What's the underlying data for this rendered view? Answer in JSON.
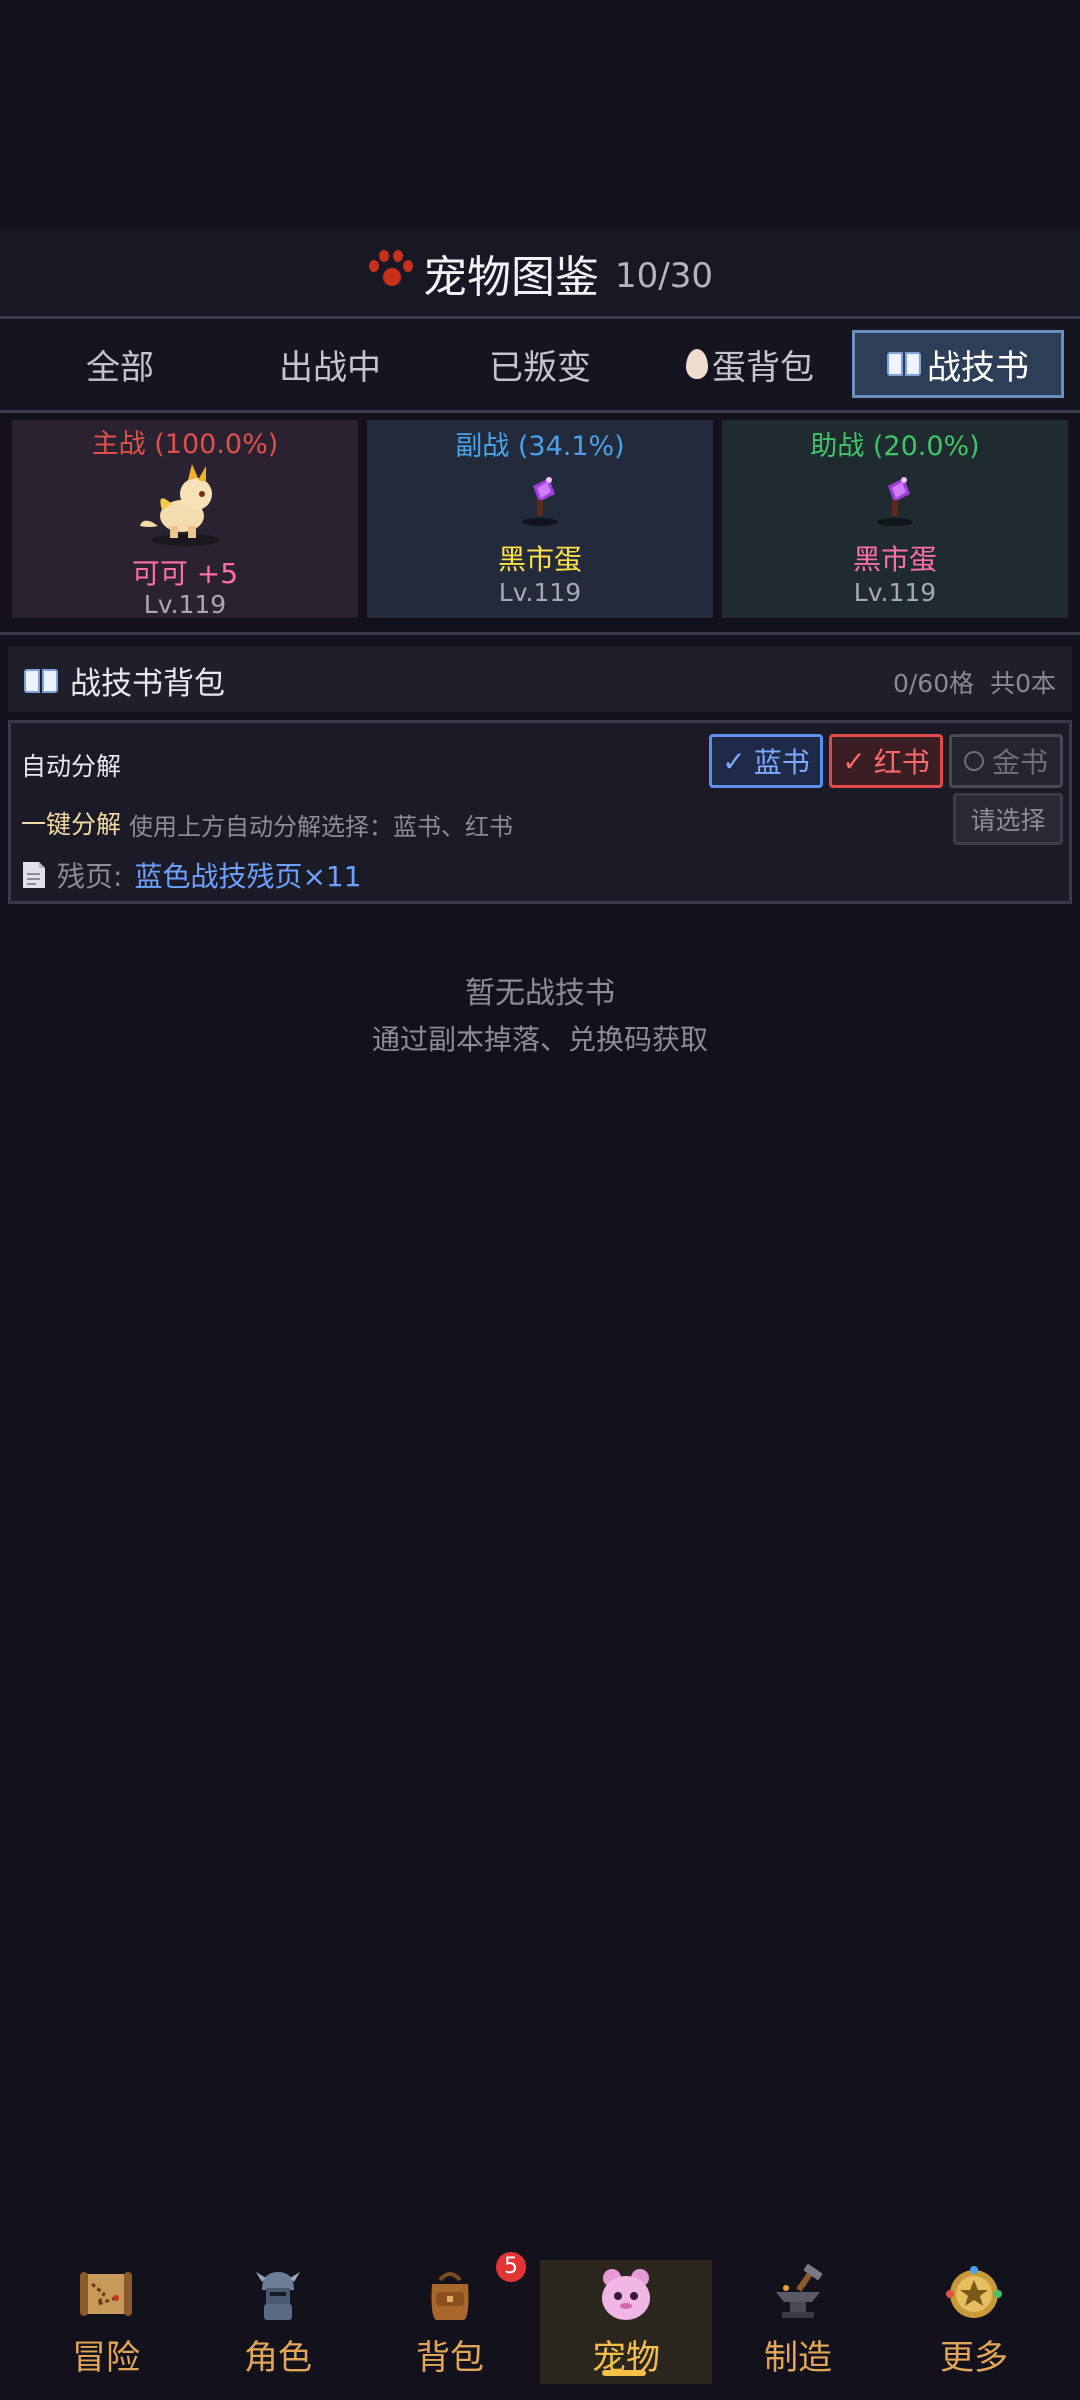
{
  "header": {
    "title": "宠物图鉴",
    "count": "10/30"
  },
  "tabs": [
    {
      "label": "全部",
      "active": false
    },
    {
      "label": "出战中",
      "active": false
    },
    {
      "label": "已叛变",
      "active": false
    },
    {
      "label": "蛋背包",
      "active": false,
      "icon": "egg-icon"
    },
    {
      "label": "战技书",
      "active": true,
      "icon": "book-icon"
    }
  ],
  "pet_slots": [
    {
      "role": "主战 (100.0%)",
      "name": "可可 +5",
      "level": "Lv.119",
      "color": "#e0504a",
      "name_color": "#ff6fa8",
      "bg": "#2a2230"
    },
    {
      "role": "副战 (34.1%)",
      "name": "黑市蛋",
      "level": "Lv.119",
      "color": "#4aa3e8",
      "name_color": "#ffe046",
      "bg": "#232a3c"
    },
    {
      "role": "助战 (20.0%)",
      "name": "黑市蛋",
      "level": "Lv.119",
      "color": "#3ec46a",
      "name_color": "#ff6fa8",
      "bg": "#1f2b2e"
    }
  ],
  "bag": {
    "title": "战技书背包",
    "slots": "0/60格",
    "total": "共0本"
  },
  "auto": {
    "label": "自动分解",
    "options": [
      {
        "label": "蓝书",
        "checked": true,
        "color": "#5b8ff0"
      },
      {
        "label": "红书",
        "checked": true,
        "color": "#e24a4a"
      },
      {
        "label": "金书",
        "checked": false,
        "color": "#6a6a74"
      }
    ],
    "one_click_label": "一键分解",
    "one_click_desc": "使用上方自动分解选择：蓝书、红书",
    "select_button": "请选择",
    "fragment_label": "残页:",
    "fragment_value": "蓝色战技残页×11"
  },
  "empty": {
    "title": "暂无战技书",
    "hint": "通过副本掉落、兑换码获取"
  },
  "nav": [
    {
      "label": "冒险",
      "icon": "map-scroll-icon",
      "active": false
    },
    {
      "label": "角色",
      "icon": "knight-icon",
      "active": false
    },
    {
      "label": "背包",
      "icon": "bag-icon",
      "active": false,
      "badge": "5"
    },
    {
      "label": "宠物",
      "icon": "pet-icon",
      "active": true
    },
    {
      "label": "制造",
      "icon": "anvil-icon",
      "active": false
    },
    {
      "label": "更多",
      "icon": "star-medal-icon",
      "active": false
    }
  ]
}
